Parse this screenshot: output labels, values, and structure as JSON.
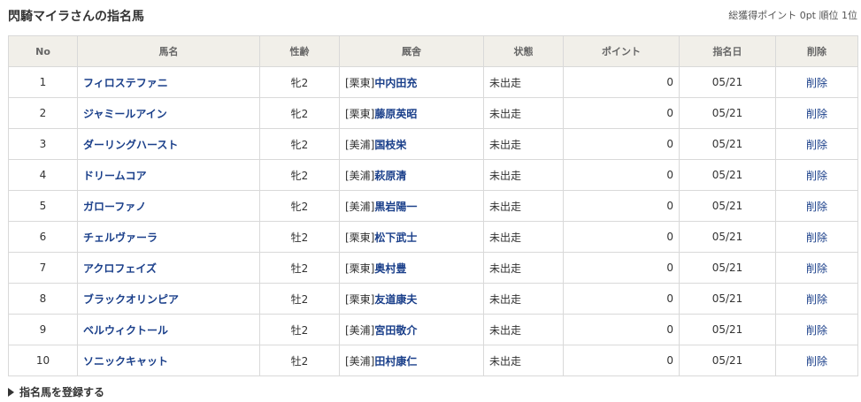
{
  "header": {
    "title": "閃騎マイラさんの指名馬",
    "summary": "総獲得ポイント 0pt 順位 1位"
  },
  "table": {
    "columns": [
      "No",
      "馬名",
      "性齢",
      "厩舎",
      "状態",
      "ポイント",
      "指名日",
      "削除"
    ],
    "rows": [
      {
        "no": "1",
        "name": "フィロステファニ",
        "sex_age": "牝2",
        "stable_region": "[栗東]",
        "trainer": "中内田充",
        "status": "未出走",
        "points": "0",
        "date": "05/21",
        "delete": "削除"
      },
      {
        "no": "2",
        "name": "ジャミールアイン",
        "sex_age": "牝2",
        "stable_region": "[栗東]",
        "trainer": "藤原英昭",
        "status": "未出走",
        "points": "0",
        "date": "05/21",
        "delete": "削除"
      },
      {
        "no": "3",
        "name": "ダーリングハースト",
        "sex_age": "牝2",
        "stable_region": "[美浦]",
        "trainer": "国枝栄",
        "status": "未出走",
        "points": "0",
        "date": "05/21",
        "delete": "削除"
      },
      {
        "no": "4",
        "name": "ドリームコア",
        "sex_age": "牝2",
        "stable_region": "[美浦]",
        "trainer": "萩原清",
        "status": "未出走",
        "points": "0",
        "date": "05/21",
        "delete": "削除"
      },
      {
        "no": "5",
        "name": "ガローファノ",
        "sex_age": "牝2",
        "stable_region": "[美浦]",
        "trainer": "黒岩陽一",
        "status": "未出走",
        "points": "0",
        "date": "05/21",
        "delete": "削除"
      },
      {
        "no": "6",
        "name": "チェルヴァーラ",
        "sex_age": "牡2",
        "stable_region": "[栗東]",
        "trainer": "松下武士",
        "status": "未出走",
        "points": "0",
        "date": "05/21",
        "delete": "削除"
      },
      {
        "no": "7",
        "name": "アクロフェイズ",
        "sex_age": "牡2",
        "stable_region": "[栗東]",
        "trainer": "奥村豊",
        "status": "未出走",
        "points": "0",
        "date": "05/21",
        "delete": "削除"
      },
      {
        "no": "8",
        "name": "ブラックオリンピア",
        "sex_age": "牡2",
        "stable_region": "[栗東]",
        "trainer": "友道康夫",
        "status": "未出走",
        "points": "0",
        "date": "05/21",
        "delete": "削除"
      },
      {
        "no": "9",
        "name": "ベルウィクトール",
        "sex_age": "牡2",
        "stable_region": "[美浦]",
        "trainer": "宮田敬介",
        "status": "未出走",
        "points": "0",
        "date": "05/21",
        "delete": "削除"
      },
      {
        "no": "10",
        "name": "ソニックキャット",
        "sex_age": "牡2",
        "stable_region": "[美浦]",
        "trainer": "田村康仁",
        "status": "未出走",
        "points": "0",
        "date": "05/21",
        "delete": "削除"
      }
    ]
  },
  "footer": {
    "register_link": "指名馬を登録する",
    "icon": "triangle-right-icon"
  },
  "colors": {
    "link": "#1a3f8a",
    "header_bg": "#f1efe9",
    "border": "#d9d9d9"
  }
}
